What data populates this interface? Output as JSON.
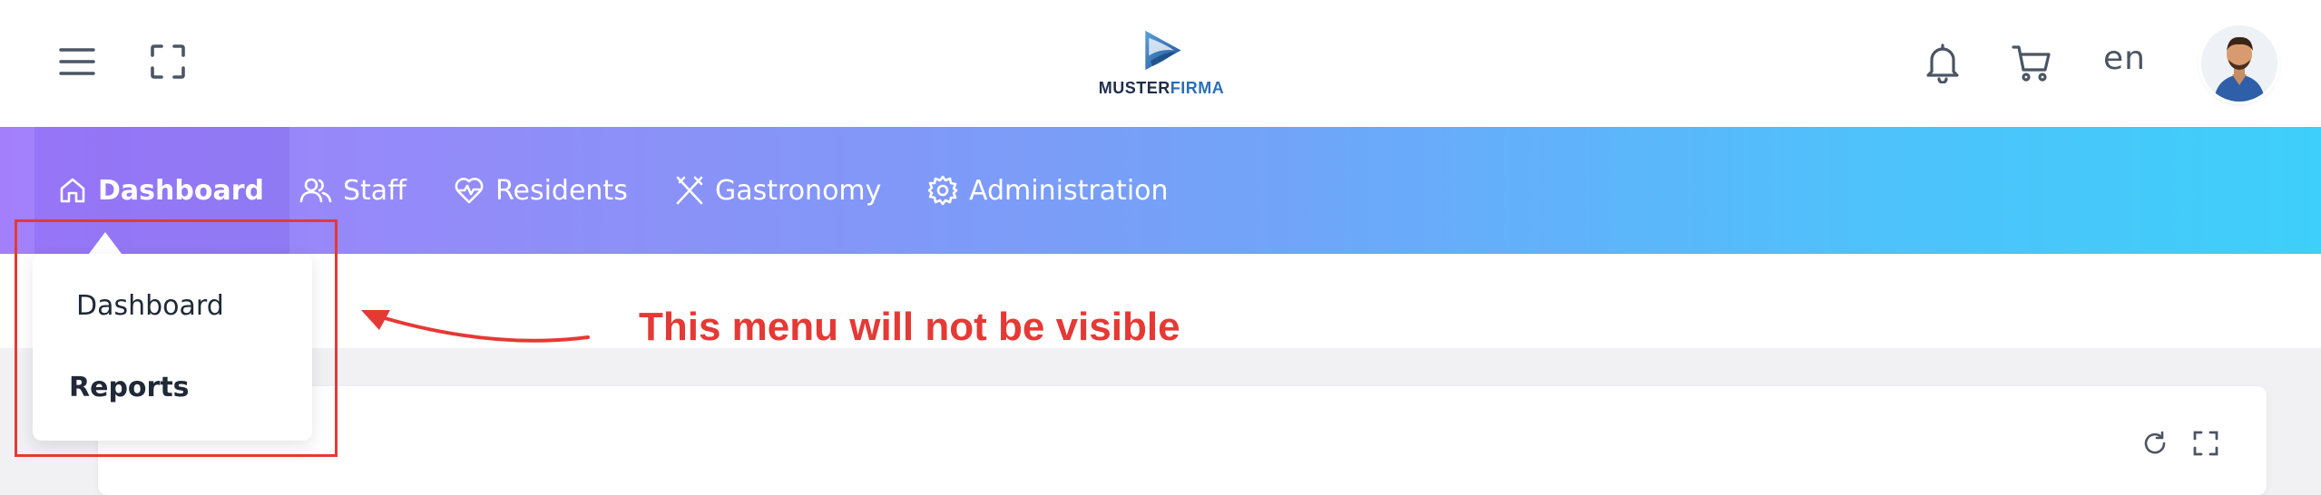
{
  "header": {
    "logo": {
      "text_part1": "MUSTER",
      "text_part2": "FIRMA"
    },
    "language": "en",
    "icons": [
      "hamburger-menu-icon",
      "fullscreen-icon",
      "bell-icon",
      "cart-icon"
    ]
  },
  "nav": {
    "items": [
      {
        "label": "Dashboard",
        "icon": "home-icon",
        "active": true
      },
      {
        "label": "Staff",
        "icon": "users-icon"
      },
      {
        "label": "Residents",
        "icon": "heart-pulse-icon"
      },
      {
        "label": "Gastronomy",
        "icon": "fork-knife-icon"
      },
      {
        "label": "Administration",
        "icon": "gear-icon"
      }
    ]
  },
  "dropdown": {
    "items": [
      {
        "label": "Dashboard"
      },
      {
        "label": "Reports"
      }
    ]
  },
  "annotation": {
    "text": "This menu will not be visible",
    "color": "#e53935"
  },
  "card": {
    "icons": [
      "refresh-icon",
      "fullscreen-icon"
    ]
  },
  "colors": {
    "nav_gradient_start": "#a47ffc",
    "nav_gradient_end": "#3ecffa",
    "annotation_red": "#e53935"
  }
}
